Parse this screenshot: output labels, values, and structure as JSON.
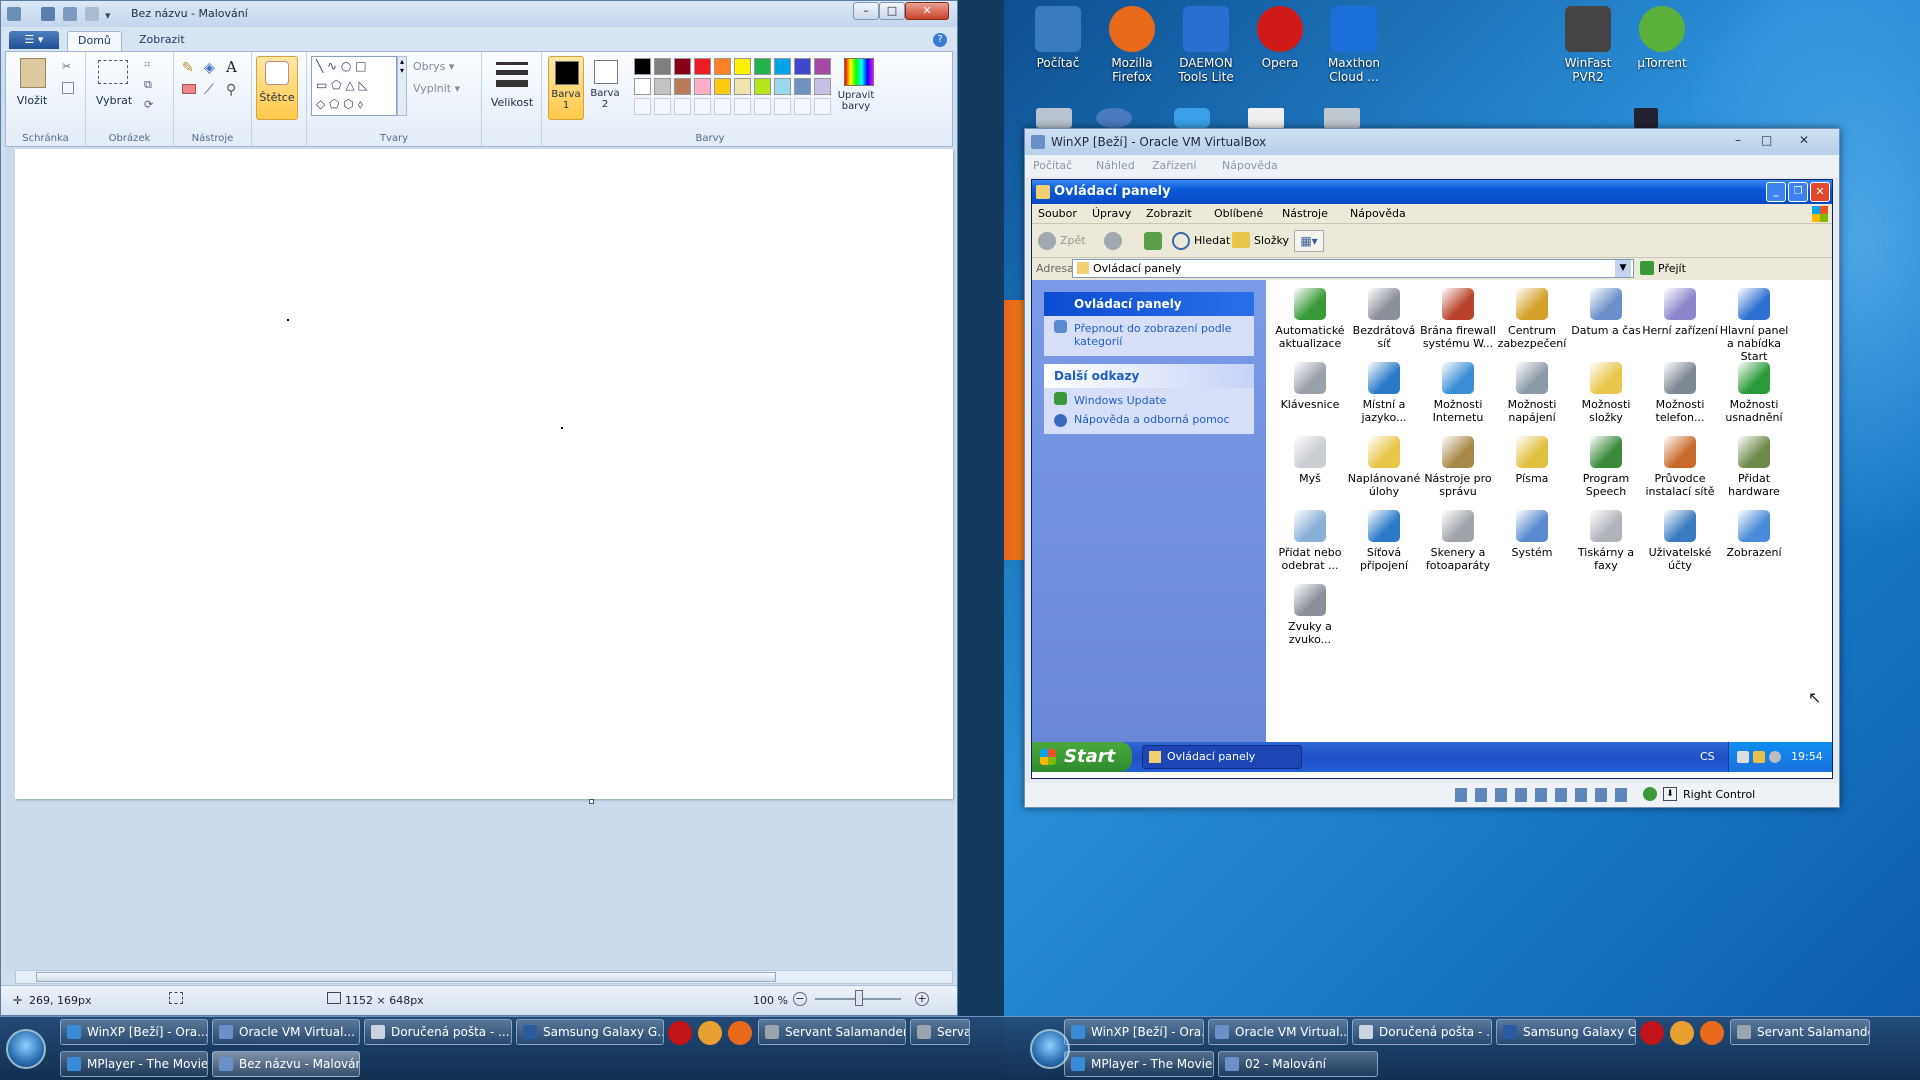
{
  "paint": {
    "title": "Bez názvu - Malování",
    "tabs": [
      "Domů",
      "Zobrazit"
    ],
    "groups": {
      "clipboard": {
        "label": "Schránka",
        "paste": "Vložit"
      },
      "image": {
        "label": "Obrázek",
        "select": "Vybrat"
      },
      "tools": {
        "label": "Nástroje"
      },
      "brushes": {
        "label": "Štětce"
      },
      "shapes": {
        "label": "Tvary",
        "outline": "Obrys",
        "fill": "Vyplnit"
      },
      "size": {
        "label": "Velikost"
      },
      "colors": {
        "label": "Barvy",
        "color1": "Barva 1",
        "color2": "Barva 2",
        "edit": "Upravit barvy"
      }
    },
    "palette": [
      "#000000",
      "#7f7f7f",
      "#880015",
      "#ed1c24",
      "#ff7f27",
      "#fff200",
      "#22b14c",
      "#00a2e8",
      "#3f48cc",
      "#a349a4",
      "#ffffff",
      "#c3c3c3",
      "#b97a57",
      "#ffaec9",
      "#ffc90e",
      "#efe4b0",
      "#b5e61d",
      "#99d9ea",
      "#7092be",
      "#c8bfe7"
    ],
    "status": {
      "cursor": "269, 169px",
      "size": "1152 × 648px",
      "zoom": "100 %"
    }
  },
  "left_taskbar": {
    "row1": [
      "WinXP [Beží] - Ora...",
      "Oracle VM Virtual...",
      "Doručená pošta - ...",
      "Samsung Galaxy G...",
      "Servant Salamander",
      "Servant S"
    ],
    "row2": [
      "MPlayer - The Movie...",
      "Bez názvu - Malování"
    ]
  },
  "desktop": {
    "icons": [
      "Počítač",
      "Mozilla Firefox",
      "DAEMON Tools Lite",
      "Opera",
      "Maxthon Cloud ...",
      "WinFast PVR2",
      "µTorrent"
    ]
  },
  "vbox": {
    "title": "WinXP [Beží] - Oracle VM VirtualBox",
    "menu": [
      "Počítač",
      "Náhled",
      "Zařízení",
      "Nápověda"
    ],
    "status": "Right Control"
  },
  "xp": {
    "title": "Ovládací panely",
    "menu": [
      "Soubor",
      "Úpravy",
      "Zobrazit",
      "Oblíbené",
      "Nástroje",
      "Nápověda"
    ],
    "toolbar": {
      "back": "Zpět",
      "search": "Hledat",
      "folders": "Složky"
    },
    "address": {
      "label": "Adresa",
      "value": "Ovládací panely",
      "go": "Přejít"
    },
    "side": {
      "panel_title": "Ovládací panely",
      "switch_link": "Přepnout do zobrazení podle kategorií",
      "links_title": "Další odkazy",
      "links": [
        "Windows Update",
        "Nápověda a odborná pomoc"
      ]
    },
    "items": [
      {
        "label": "Automatické aktualizace",
        "color": "#3a9a3a"
      },
      {
        "label": "Bezdrátová síť",
        "color": "#8a8f99"
      },
      {
        "label": "Brána firewall systému W...",
        "color": "#b8432a"
      },
      {
        "label": "Centrum zabezpečení",
        "color": "#d4a12a"
      },
      {
        "label": "Datum a čas",
        "color": "#6b8fc8"
      },
      {
        "label": "Herní zařízení",
        "color": "#8a86c9"
      },
      {
        "label": "Hlavní panel a nabídka Start",
        "color": "#2f6fd0"
      },
      {
        "label": "Klávesnice",
        "color": "#9aa0aa"
      },
      {
        "label": "Místní a jazyko...",
        "color": "#2a7ac9"
      },
      {
        "label": "Možnosti Internetu",
        "color": "#3b8ed6"
      },
      {
        "label": "Možnosti napájení",
        "color": "#8c9aa8"
      },
      {
        "label": "Možnosti složky",
        "color": "#e8c64a"
      },
      {
        "label": "Možnosti telefon...",
        "color": "#7d8893"
      },
      {
        "label": "Možnosti usnadnění",
        "color": "#2a9a3a"
      },
      {
        "label": "Myš",
        "color": "#c9ccd1"
      },
      {
        "label": "Naplánované úlohy",
        "color": "#e8c64a"
      },
      {
        "label": "Nástroje pro správu",
        "color": "#a8894a"
      },
      {
        "label": "Písma",
        "color": "#e0c040"
      },
      {
        "label": "Program Speech",
        "color": "#3b8a3b"
      },
      {
        "label": "Průvodce instalací sítě",
        "color": "#c96a2a"
      },
      {
        "label": "Přidat hardware",
        "color": "#6e8a4a"
      },
      {
        "label": "Přidat nebo odebrat ...",
        "color": "#8ab0d8"
      },
      {
        "label": "Síťová připojení",
        "color": "#2a7ac9"
      },
      {
        "label": "Skenery a fotoaparáty",
        "color": "#a0a4aa"
      },
      {
        "label": "Systém",
        "color": "#5a8ad0"
      },
      {
        "label": "Tiskárny a faxy",
        "color": "#b0b4ba"
      },
      {
        "label": "Uživatelské účty",
        "color": "#3a7ac0"
      },
      {
        "label": "Zobrazení",
        "color": "#4a8ad8"
      },
      {
        "label": "Zvuky a zvuko...",
        "color": "#8a8f99"
      }
    ],
    "taskbar": {
      "start": "Start",
      "window": "Ovládací panely",
      "lang": "CS",
      "time": "19:54"
    }
  },
  "right_taskbar": {
    "row1": [
      "WinXP [Beží] - Ora...",
      "Oracle VM Virtual...",
      "Doručená pošta - ...",
      "Samsung Galaxy G...",
      "Servant Salamander"
    ],
    "row2": [
      "MPlayer - The Movie...",
      "02 - Malování"
    ]
  }
}
